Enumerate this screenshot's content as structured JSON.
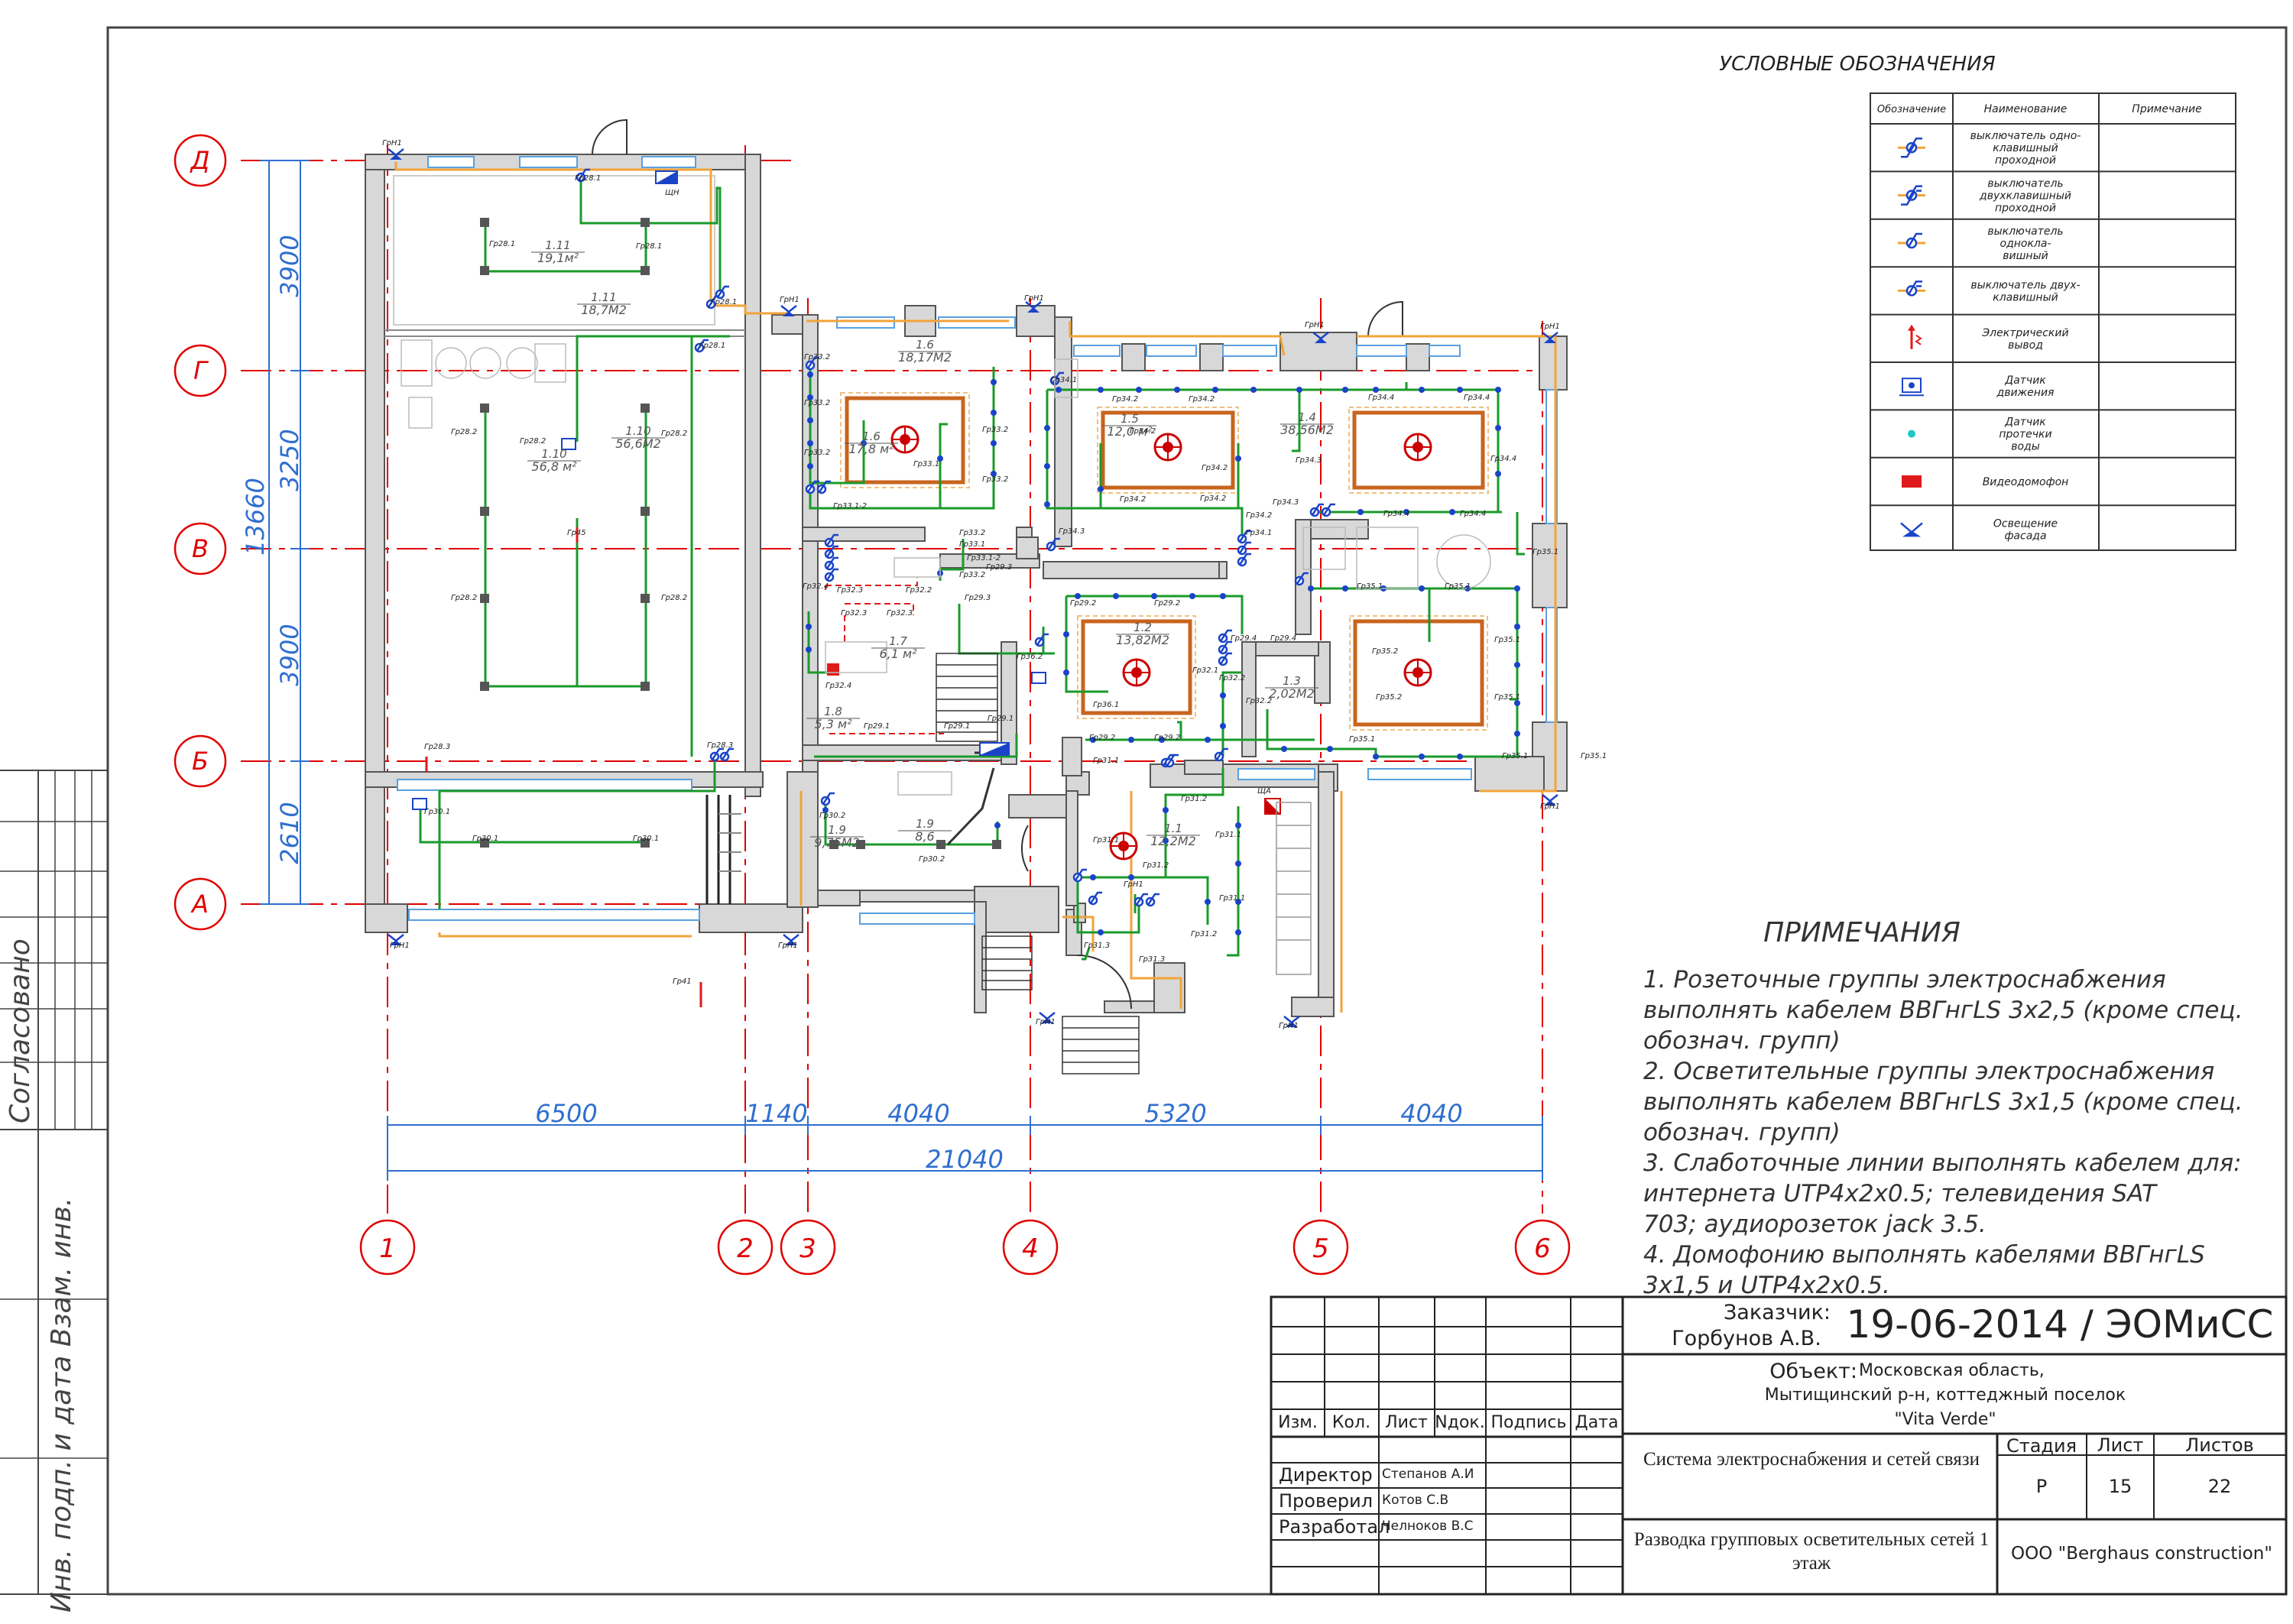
{
  "legend": {
    "title": "УСЛОВНЫЕ ОБОЗНАЧЕНИЯ",
    "headers": [
      "Обозначение",
      "Наименование",
      "Примечание"
    ],
    "items": [
      {
        "icon": "switch-one-key-pass-icon",
        "lines": [
          "выключатель одно-",
          "клавишный",
          "проходной"
        ]
      },
      {
        "icon": "switch-two-key-pass-icon",
        "lines": [
          "выключатель",
          "двухклавишный",
          "проходной"
        ]
      },
      {
        "icon": "switch-one-key-icon",
        "lines": [
          "выключатель",
          "одноклa-",
          "вишный"
        ]
      },
      {
        "icon": "switch-two-key-icon",
        "lines": [
          "выключатель двух-",
          "клавишный"
        ]
      },
      {
        "icon": "electric-outlet-icon",
        "lines": [
          "Электрический",
          "вывод"
        ]
      },
      {
        "icon": "motion-sensor-icon",
        "lines": [
          "Датчик",
          "движения"
        ]
      },
      {
        "icon": "water-leak-sensor-icon",
        "lines": [
          "Датчик",
          "протечки",
          "воды"
        ]
      },
      {
        "icon": "intercom-icon",
        "lines": [
          "Видеодомофон"
        ]
      },
      {
        "icon": "facade-light-icon",
        "lines": [
          "Освещение",
          "фасада"
        ]
      }
    ]
  },
  "notes": {
    "title": "ПРИМЕЧАНИЯ",
    "lines": [
      "1. Розеточные группы электроснабжения",
      "выполнять кабелем ВВГнгLS 3х2,5 (кроме спец.",
      "обознач. групп)",
      "2. Осветительные группы электроснабжения",
      "выполнять кабелем ВВГнгLS 3х1,5 (кроме спец.",
      "обознач. групп)",
      "3. Слаботочные линии выполнять кабелем для:",
      "интернета     UTP4x2x0.5; телевидения   SAT",
      "703; аудиорозеток jack 3.5.",
      "4. Домофонию выполнять кабелями ВВГнгLS",
      "3х1,5  и UTP4x2x0.5."
    ]
  },
  "axes": {
    "letters": [
      "Д",
      "Г",
      "В",
      "Б",
      "А"
    ],
    "numbers": [
      "1",
      "2",
      "3",
      "4",
      "5",
      "6"
    ],
    "vertical_dims": [
      "3900",
      "3250",
      "3900",
      "2610"
    ],
    "vertical_total": "13660",
    "horizontal_dims": [
      "6500",
      "1140",
      "4040",
      "5320",
      "4040"
    ],
    "horizontal_total": "21040"
  },
  "rooms": [
    {
      "id": "1.11",
      "area": "18,7М2"
    },
    {
      "id": "1.11",
      "area": "19,1м²"
    },
    {
      "id": "1.10",
      "area": "56,6М2"
    },
    {
      "id": "1.10",
      "area": "56,8 м²"
    },
    {
      "id": "1.6",
      "area": "18,17М2"
    },
    {
      "id": "1.6",
      "area": "17,8 м²"
    },
    {
      "id": "1.5",
      "area": "12,0 м²"
    },
    {
      "id": "1.4",
      "area": "38,56М2"
    },
    {
      "id": "1.7",
      "area": "6,1 м²"
    },
    {
      "id": "1.2",
      "area": "13,82М2"
    },
    {
      "id": "1.3",
      "area": "2,02М2"
    },
    {
      "id": "1.8",
      "area": "5,3 м²"
    },
    {
      "id": "1.9",
      "area": "9,75М2"
    },
    {
      "id": "1.9",
      "area": "8,6"
    },
    {
      "id": "1.1",
      "area": "12,2М2"
    }
  ],
  "group_labels": [
    "Гр28.1",
    "Гр28.2",
    "Гр28.3",
    "Гр30.1",
    "Гр30.2",
    "Гр33.1",
    "Гр33.2",
    "Гр33.1-2",
    "Гр34.1",
    "Гр34.2",
    "Гр34.3",
    "Гр34.4",
    "Гр35.1",
    "Гр35.2",
    "Гр29.1",
    "Гр29.2",
    "Гр29.3",
    "Гр29.4",
    "Гр32.1",
    "Гр32.2",
    "Гр32.3",
    "Гр32.4",
    "Гр31.1",
    "Гр31.2",
    "Гр31.3",
    "Гр36.1",
    "Гр36.2",
    "Гр45",
    "Гр41",
    "ГрН1",
    "ЩН",
    "ЩА"
  ],
  "left_strip": {
    "agreed": "Согласовано",
    "sign": "Инв. подп. и дата  Взам. инв."
  },
  "title_block": {
    "change_headers": [
      "Изм.",
      "Кол.",
      "Лист",
      "Nдок.",
      "Подпись",
      "Дата"
    ],
    "people": [
      {
        "role": "Директор",
        "name": "Степанов А.И"
      },
      {
        "role": "Проверил",
        "name": "Котов С.В"
      },
      {
        "role": "Разработал",
        "name": "Челноков В.С"
      }
    ],
    "customer_label": "Заказчик:",
    "customer_name": "Горбунов А.В.",
    "code": "19-06-2014 / ЭОМиСС",
    "object_label": "Объект:",
    "object_lines": [
      "Московская область,",
      "Мытищинский р-н, коттеджный поселок",
      "\"Vita Verde\""
    ],
    "system": "Система электроснабжения и сетей связи",
    "sheet_title": "Разводка групповых осветительных сетей 1 этаж",
    "stage_header": "Стадия",
    "sheet_header": "Лист",
    "sheets_header": "Листов",
    "stage": "Р",
    "sheet": "15",
    "sheets": "22",
    "company": "ООО \"Berghaus construction\""
  }
}
